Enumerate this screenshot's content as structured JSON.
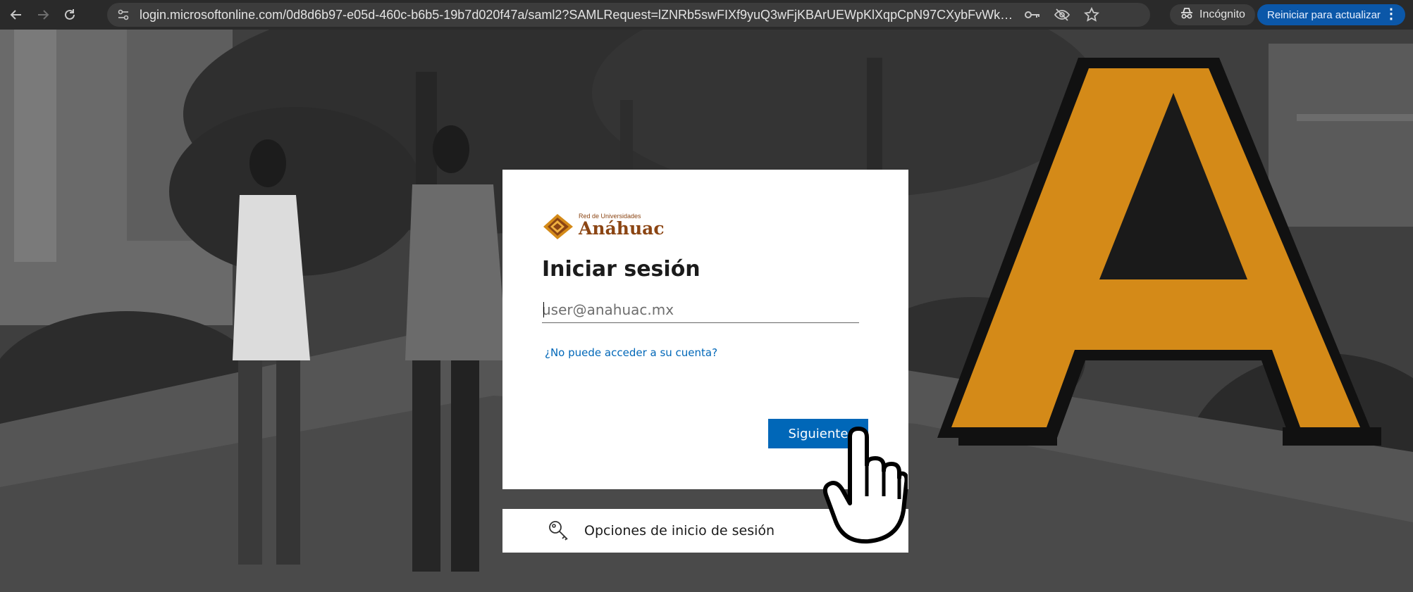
{
  "browser": {
    "url": "login.microsoftonline.com/0d8d6b97-e05d-460c-b6b5-19b7d020f47a/saml2?SAMLRequest=lZNRb5swFIXf9yuQ3wFjKBArUEWpKlXqpCpN97CXybFvWktgM1%...",
    "incognito_label": "Incógnito",
    "restart_label": "Reiniciar para actualizar",
    "icons": [
      "back-arrow-icon",
      "forward-arrow-icon",
      "reload-icon",
      "site-info-icon",
      "key-icon",
      "eye-off-icon",
      "star-icon",
      "incognito-icon",
      "more-vert-icon"
    ]
  },
  "login": {
    "logo_small": "Red de Universidades",
    "logo_big": "Anáhuac",
    "title": "Iniciar sesión",
    "email_placeholder": "user@anahuac.mx",
    "email_value": "",
    "help_link": "¿No puede acceder a su cuenta?",
    "next_button": "Siguiente",
    "options_label": "Opciones de inicio de sesión"
  },
  "colors": {
    "accent": "#0067b8",
    "logo": "#8b4513",
    "letter_a": "#d48a18",
    "restart_button": "#0b57a8"
  }
}
